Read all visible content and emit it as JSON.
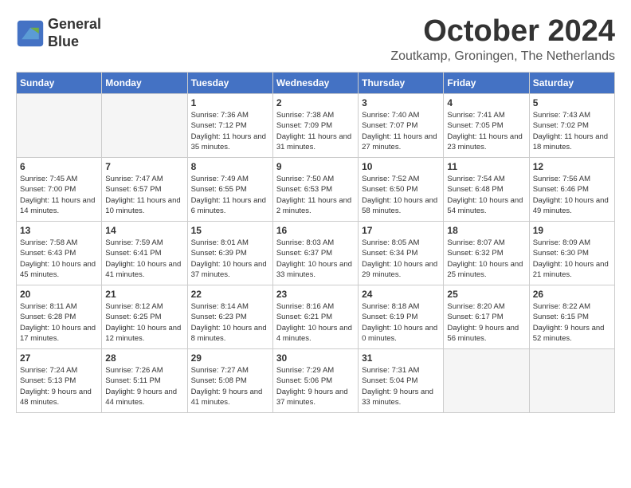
{
  "header": {
    "logo_line1": "General",
    "logo_line2": "Blue",
    "month": "October 2024",
    "location": "Zoutkamp, Groningen, The Netherlands"
  },
  "weekdays": [
    "Sunday",
    "Monday",
    "Tuesday",
    "Wednesday",
    "Thursday",
    "Friday",
    "Saturday"
  ],
  "weeks": [
    [
      {
        "day": "",
        "info": ""
      },
      {
        "day": "",
        "info": ""
      },
      {
        "day": "1",
        "info": "Sunrise: 7:36 AM\nSunset: 7:12 PM\nDaylight: 11 hours and 35 minutes."
      },
      {
        "day": "2",
        "info": "Sunrise: 7:38 AM\nSunset: 7:09 PM\nDaylight: 11 hours and 31 minutes."
      },
      {
        "day": "3",
        "info": "Sunrise: 7:40 AM\nSunset: 7:07 PM\nDaylight: 11 hours and 27 minutes."
      },
      {
        "day": "4",
        "info": "Sunrise: 7:41 AM\nSunset: 7:05 PM\nDaylight: 11 hours and 23 minutes."
      },
      {
        "day": "5",
        "info": "Sunrise: 7:43 AM\nSunset: 7:02 PM\nDaylight: 11 hours and 18 minutes."
      }
    ],
    [
      {
        "day": "6",
        "info": "Sunrise: 7:45 AM\nSunset: 7:00 PM\nDaylight: 11 hours and 14 minutes."
      },
      {
        "day": "7",
        "info": "Sunrise: 7:47 AM\nSunset: 6:57 PM\nDaylight: 11 hours and 10 minutes."
      },
      {
        "day": "8",
        "info": "Sunrise: 7:49 AM\nSunset: 6:55 PM\nDaylight: 11 hours and 6 minutes."
      },
      {
        "day": "9",
        "info": "Sunrise: 7:50 AM\nSunset: 6:53 PM\nDaylight: 11 hours and 2 minutes."
      },
      {
        "day": "10",
        "info": "Sunrise: 7:52 AM\nSunset: 6:50 PM\nDaylight: 10 hours and 58 minutes."
      },
      {
        "day": "11",
        "info": "Sunrise: 7:54 AM\nSunset: 6:48 PM\nDaylight: 10 hours and 54 minutes."
      },
      {
        "day": "12",
        "info": "Sunrise: 7:56 AM\nSunset: 6:46 PM\nDaylight: 10 hours and 49 minutes."
      }
    ],
    [
      {
        "day": "13",
        "info": "Sunrise: 7:58 AM\nSunset: 6:43 PM\nDaylight: 10 hours and 45 minutes."
      },
      {
        "day": "14",
        "info": "Sunrise: 7:59 AM\nSunset: 6:41 PM\nDaylight: 10 hours and 41 minutes."
      },
      {
        "day": "15",
        "info": "Sunrise: 8:01 AM\nSunset: 6:39 PM\nDaylight: 10 hours and 37 minutes."
      },
      {
        "day": "16",
        "info": "Sunrise: 8:03 AM\nSunset: 6:37 PM\nDaylight: 10 hours and 33 minutes."
      },
      {
        "day": "17",
        "info": "Sunrise: 8:05 AM\nSunset: 6:34 PM\nDaylight: 10 hours and 29 minutes."
      },
      {
        "day": "18",
        "info": "Sunrise: 8:07 AM\nSunset: 6:32 PM\nDaylight: 10 hours and 25 minutes."
      },
      {
        "day": "19",
        "info": "Sunrise: 8:09 AM\nSunset: 6:30 PM\nDaylight: 10 hours and 21 minutes."
      }
    ],
    [
      {
        "day": "20",
        "info": "Sunrise: 8:11 AM\nSunset: 6:28 PM\nDaylight: 10 hours and 17 minutes."
      },
      {
        "day": "21",
        "info": "Sunrise: 8:12 AM\nSunset: 6:25 PM\nDaylight: 10 hours and 12 minutes."
      },
      {
        "day": "22",
        "info": "Sunrise: 8:14 AM\nSunset: 6:23 PM\nDaylight: 10 hours and 8 minutes."
      },
      {
        "day": "23",
        "info": "Sunrise: 8:16 AM\nSunset: 6:21 PM\nDaylight: 10 hours and 4 minutes."
      },
      {
        "day": "24",
        "info": "Sunrise: 8:18 AM\nSunset: 6:19 PM\nDaylight: 10 hours and 0 minutes."
      },
      {
        "day": "25",
        "info": "Sunrise: 8:20 AM\nSunset: 6:17 PM\nDaylight: 9 hours and 56 minutes."
      },
      {
        "day": "26",
        "info": "Sunrise: 8:22 AM\nSunset: 6:15 PM\nDaylight: 9 hours and 52 minutes."
      }
    ],
    [
      {
        "day": "27",
        "info": "Sunrise: 7:24 AM\nSunset: 5:13 PM\nDaylight: 9 hours and 48 minutes."
      },
      {
        "day": "28",
        "info": "Sunrise: 7:26 AM\nSunset: 5:11 PM\nDaylight: 9 hours and 44 minutes."
      },
      {
        "day": "29",
        "info": "Sunrise: 7:27 AM\nSunset: 5:08 PM\nDaylight: 9 hours and 41 minutes."
      },
      {
        "day": "30",
        "info": "Sunrise: 7:29 AM\nSunset: 5:06 PM\nDaylight: 9 hours and 37 minutes."
      },
      {
        "day": "31",
        "info": "Sunrise: 7:31 AM\nSunset: 5:04 PM\nDaylight: 9 hours and 33 minutes."
      },
      {
        "day": "",
        "info": ""
      },
      {
        "day": "",
        "info": ""
      }
    ]
  ]
}
